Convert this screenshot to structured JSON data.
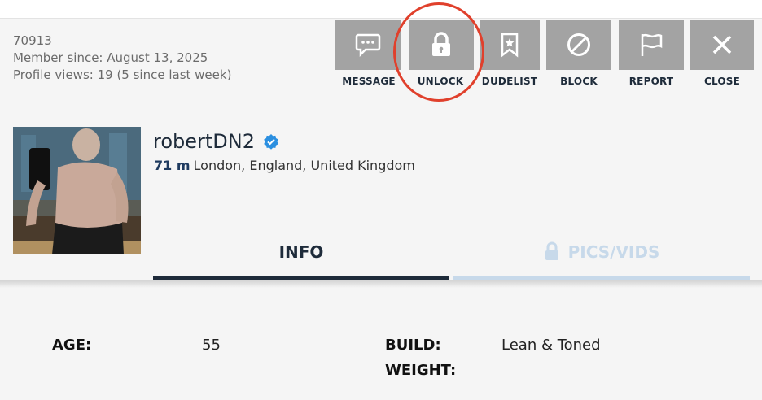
{
  "profile": {
    "id": "70913",
    "member_since": "Member since: August 13, 2025",
    "profile_views": "Profile views: 19 (5 since last week)",
    "username": "robertDN2",
    "distance": "71 m",
    "location": "London, England, United Kingdom"
  },
  "actions": [
    {
      "label": "MESSAGE",
      "icon": "message-icon"
    },
    {
      "label": "UNLOCK",
      "icon": "lock-icon"
    },
    {
      "label": "DUDELIST",
      "icon": "bookmark-star-icon"
    },
    {
      "label": "BLOCK",
      "icon": "block-icon"
    },
    {
      "label": "REPORT",
      "icon": "flag-icon"
    },
    {
      "label": "CLOSE",
      "icon": "close-icon"
    }
  ],
  "tabs": {
    "info": "INFO",
    "pics": "PICS/VIDS"
  },
  "fields": {
    "age_label": "AGE:",
    "age_value": "55",
    "build_label": "BUILD:",
    "build_value": "Lean & Toned",
    "weight_label": "WEIGHT:"
  },
  "colors": {
    "button_bg": "#a3a3a3",
    "accent_dark": "#1e2b3a",
    "tab_inactive": "#c7d9ea",
    "highlight_circle": "#e0402c",
    "verified": "#2b8fe0"
  }
}
